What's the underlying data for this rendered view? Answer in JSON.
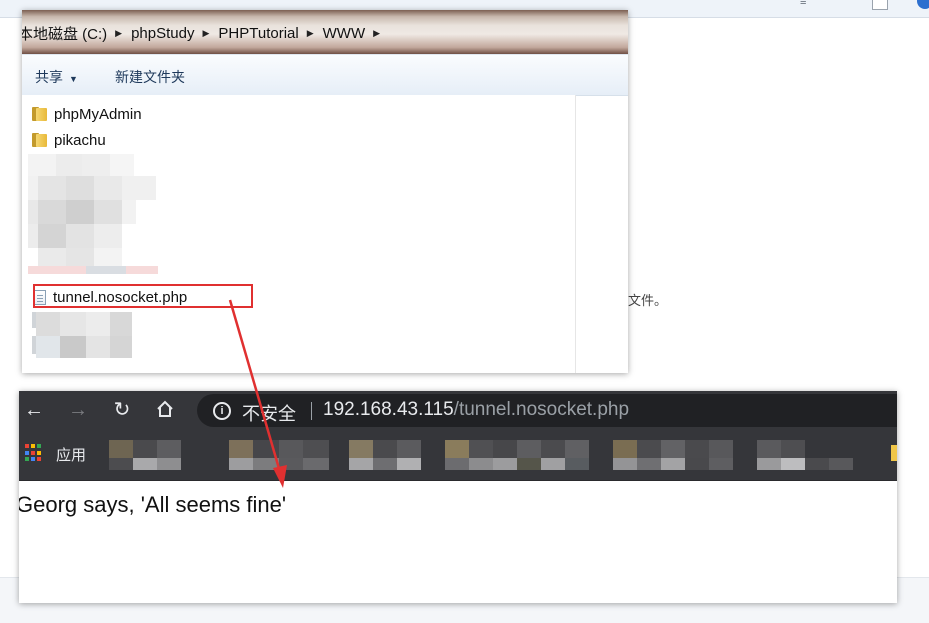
{
  "explorer": {
    "breadcrumb": [
      "本地磁盘 (C:)",
      "phpStudy",
      "PHPTutorial",
      "WWW"
    ],
    "toolbar": {
      "share_label": "共享",
      "new_folder_label": "新建文件夹"
    },
    "files": [
      {
        "name": "phpMyAdmin",
        "type": "folder"
      },
      {
        "name": "pikachu",
        "type": "folder"
      },
      {
        "name": "tunnel.nosocket.php",
        "type": "php-file",
        "highlighted": true
      }
    ]
  },
  "background": {
    "partial_text": "文件。"
  },
  "browser": {
    "security_label": "不安全",
    "url_host": "192.168.43.115",
    "url_path": "/tunnel.nosocket.php",
    "bookmarks_apps_label": "应用",
    "page_text": "Georg says, 'All seems fine'"
  },
  "colors": {
    "annotation": "#e03030",
    "browser_chrome": "#35363a",
    "omnibox": "#202124"
  }
}
